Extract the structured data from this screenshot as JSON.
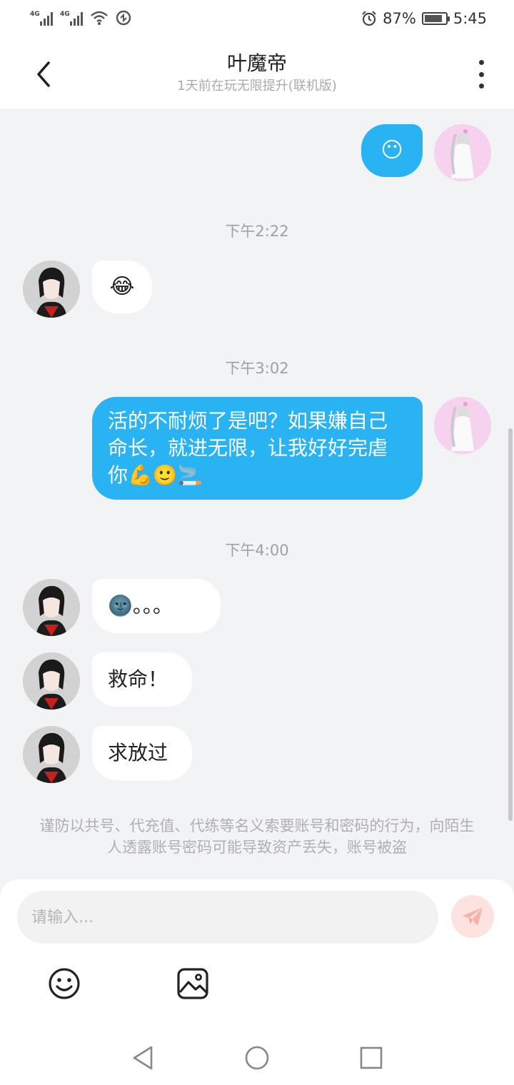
{
  "status_bar": {
    "signal_1": "4G",
    "signal_2": "4G",
    "battery_percent": "87%",
    "battery_level": 0.87,
    "time": "5:45",
    "icons": [
      "signal-icon",
      "wifi-icon",
      "nfc-icon",
      "alarm-icon",
      "battery-icon"
    ]
  },
  "header": {
    "title": "叶魔帝",
    "subtitle": "1天前在玩无限提升(联机版)"
  },
  "messages": {
    "m1": {
      "from": "me",
      "content": "😶"
    },
    "t1": "下午2:22",
    "m2": {
      "from": "other",
      "content": "😂"
    },
    "t2": "下午3:02",
    "m3": {
      "from": "me",
      "content": "活的不耐烦了是吧？如果嫌自己命长，就进无限，让我好好完虐你💪🙂🚬"
    },
    "t3": "下午4:00",
    "m4": {
      "from": "other",
      "content": "🌚。。。"
    },
    "m5": {
      "from": "other",
      "content": "救命！"
    },
    "m6": {
      "from": "other",
      "content": "求放过"
    }
  },
  "notice": "谨防以共号、代充值、代练等名义索要账号和密码的行为，向陌生人透露账号密码可能导致资产丢失，账号被盗",
  "composer": {
    "placeholder": "请输入...",
    "value": ""
  },
  "colors": {
    "my_bubble": "#29b3f3",
    "other_bubble": "#ffffff",
    "background": "#f2f3f5",
    "send_button": "#fde3df"
  }
}
